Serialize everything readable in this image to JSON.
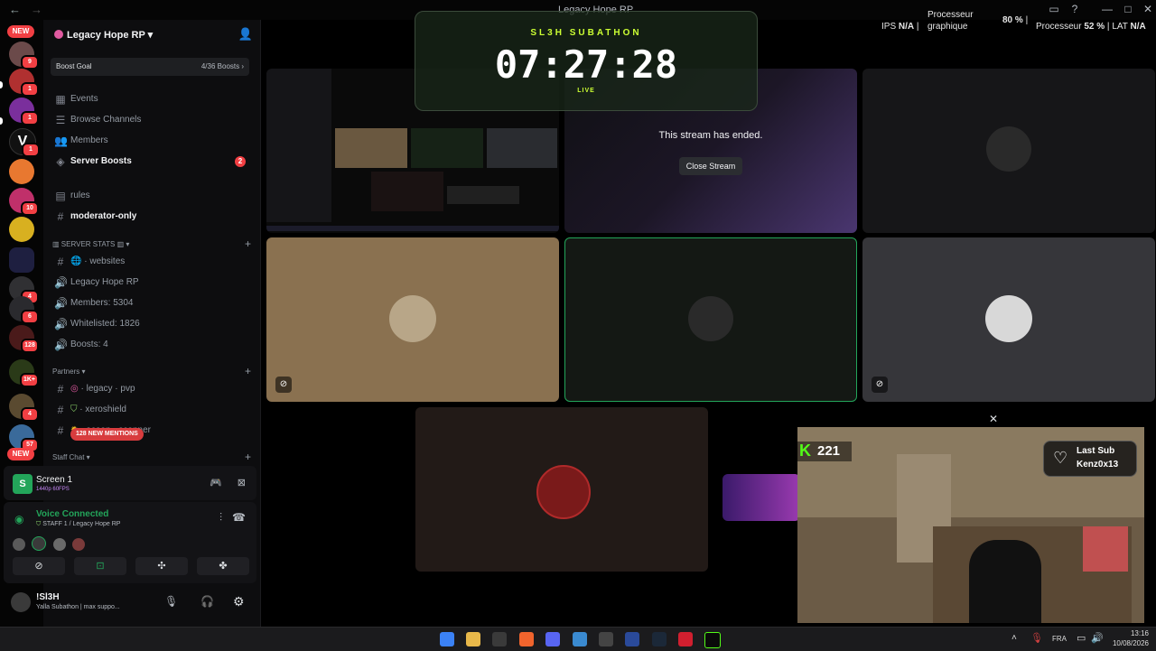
{
  "window": {
    "title": "Legacy Hope RP"
  },
  "perf": {
    "ips_label": "IPS",
    "ips_value": "N/A",
    "gpu_label": "Processeur graphique",
    "gpu_value": "80 %",
    "cpu_label": "Processeur",
    "cpu_value": "52 %",
    "lat_label": "LAT",
    "lat_value": "N/A"
  },
  "rail": {
    "new_top": "NEW",
    "new_bottom": "NEW",
    "badges": [
      "9",
      "1",
      "1",
      "1",
      "10",
      "4",
      "6",
      "128",
      "1K+",
      "4",
      "57"
    ]
  },
  "server": {
    "name": "Legacy Hope RP",
    "boost_goal_label": "Boost Goal",
    "boost_goal_value": "4/36 Boosts"
  },
  "channels": {
    "events": "Events",
    "browse": "Browse Channels",
    "members": "Members",
    "boosts": "Server Boosts",
    "boosts_badge": "2",
    "rules": "rules",
    "moderator": "moderator-only",
    "cat_stats": "SERVER STATS",
    "websites": "· websites",
    "legacy_rp": "Legacy Hope RP",
    "member_count": "Members: 5304",
    "whitelisted": "Whitelisted: 1826",
    "boost_count": "Boosts: 4",
    "cat_partners": "Partners",
    "legacy_pvp": "· legacy · pvp",
    "xeroshield": "· xeroshield",
    "ocean": "· ocean · scanner",
    "cat_staff": "Staff Chat",
    "mentions": "128 NEW MENTIONS"
  },
  "screen_panel": {
    "title": "Screen 1",
    "quality": "1440p 60FPS"
  },
  "voice": {
    "status": "Voice Connected",
    "location": "STAFF 1 / Legacy Hope RP"
  },
  "user": {
    "name": "!Sl3H",
    "status": "Yalla Subathon | max suppo..."
  },
  "stage": {
    "ended_text": "This stream has ended.",
    "close_stream": "Close Stream"
  },
  "timer": {
    "title": "SL3H SUBATHON",
    "time": "07:27:28",
    "live": "LIVE"
  },
  "overlay": {
    "kick_count": "221",
    "last_sub_label": "Last Sub",
    "last_sub_name": "Kenz0x13",
    "close": "✕"
  },
  "tray": {
    "lang": "FRA",
    "time": "13:16",
    "date": "10/08/2026"
  }
}
